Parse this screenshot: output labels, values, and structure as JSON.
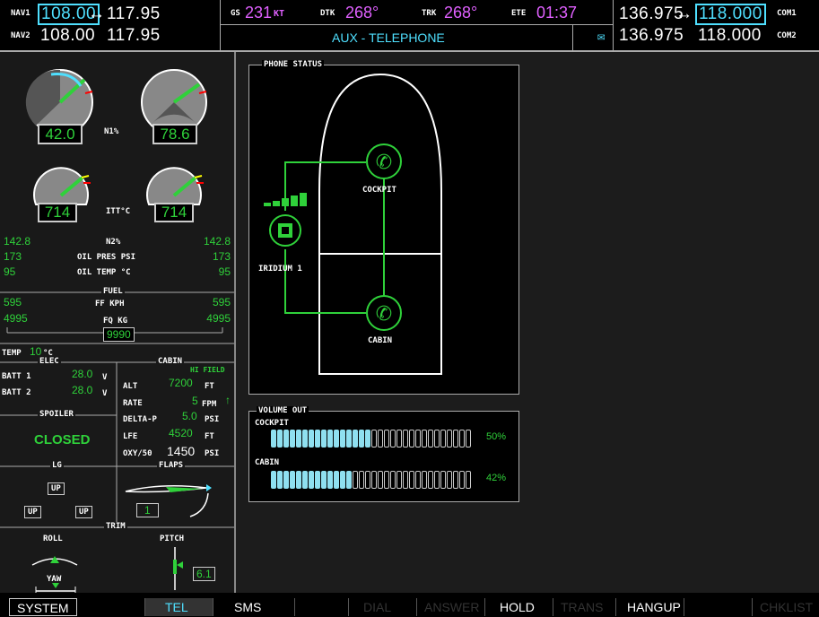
{
  "topbar": {
    "nav1_label": "NAV1",
    "nav1_active": "108.00",
    "nav1_arrow": "↔",
    "nav1_standby": "117.95",
    "nav2_label": "NAV2",
    "nav2_active": "108.00",
    "nav2_standby": "117.95",
    "gs_label": "GS",
    "gs_value": "231",
    "gs_unit": "KT",
    "dtk_label": "DTK",
    "dtk_value": "268°",
    "trk_label": "TRK",
    "trk_value": "268°",
    "ete_label": "ETE",
    "ete_value": "01:37",
    "page_title": "AUX - TELEPHONE",
    "com1_standby": "136.975",
    "com1_arrow": "↔",
    "com1_active": "118.000",
    "com1_label": "COM1",
    "com2_standby": "136.975",
    "com2_active": "118.000",
    "com2_label": "COM2"
  },
  "eis": {
    "n1_label": "N1%",
    "n1_left": "42.0",
    "n1_right": "78.6",
    "itt_label": "ITT°C",
    "itt_left": "714",
    "itt_right": "714",
    "n2_label": "N2%",
    "n2_left": "142.8",
    "n2_right": "142.8",
    "oil_pres_label": "OIL PRES PSI",
    "oil_pres_left": "173",
    "oil_pres_right": "173",
    "oil_temp_label": "OIL TEMP °C",
    "oil_temp_left": "95",
    "oil_temp_right": "95",
    "fuel_label": "FUEL",
    "ff_label": "FF KPH",
    "ff_left": "595",
    "ff_right": "595",
    "fq_label": "FQ KG",
    "fq_left": "4995",
    "fq_right": "4995",
    "fq_total": "9990",
    "temp_label": "TEMP",
    "temp_value": "10",
    "temp_unit": "°C",
    "elec_label": "ELEC",
    "batt1_label": "BATT 1",
    "batt1_value": "28.0",
    "batt2_label": "BATT 2",
    "batt2_value": "28.0",
    "volt_unit": "V",
    "cabin_label": "CABIN",
    "hi_field": "HI FIELD",
    "alt_label": "ALT",
    "alt_value": "7200",
    "alt_unit": "FT",
    "rate_label": "RATE",
    "rate_value": "5",
    "rate_unit": "FPM",
    "rate_arrow": "↑",
    "deltap_label": "DELTA-P",
    "deltap_value": "5.0",
    "deltap_unit": "PSI",
    "lfe_label": "LFE",
    "lfe_value": "4520",
    "lfe_unit": "FT",
    "oxy_label": "OXY/50",
    "oxy_value": "1450",
    "oxy_unit": "PSI",
    "spoiler_label": "SPOILER",
    "spoiler_value": "CLOSED",
    "lg_label": "LG",
    "lg_nose": "UP",
    "lg_left": "UP",
    "lg_right": "UP",
    "flaps_label": "FLAPS",
    "flaps_value": "1",
    "trim_label": "TRIM",
    "roll_label": "ROLL",
    "pitch_label": "PITCH",
    "yaw_label": "YAW",
    "pitch_value": "6.1"
  },
  "phone_status": {
    "title": "PHONE STATUS",
    "cockpit_label": "COCKPIT",
    "cabin_label": "CABIN",
    "iridium_label": "IRIDIUM 1",
    "signal_bars": 5
  },
  "volume_out": {
    "title": "VOLUME OUT",
    "cockpit_label": "COCKPIT",
    "cockpit_percent": "50%",
    "cockpit_level": 0.5,
    "cabin_label": "CABIN",
    "cabin_percent": "42%",
    "cabin_level": 0.42
  },
  "softkeys": [
    "SYSTEM",
    "",
    "TEL",
    "SMS",
    "",
    "DIAL",
    "ANSWER",
    "HOLD",
    "TRANS",
    "HANGUP",
    "",
    "CHKLIST"
  ],
  "colors": {
    "cyan": "#4fe0ff",
    "green": "#2fd13a",
    "magenta": "#e060ff"
  }
}
